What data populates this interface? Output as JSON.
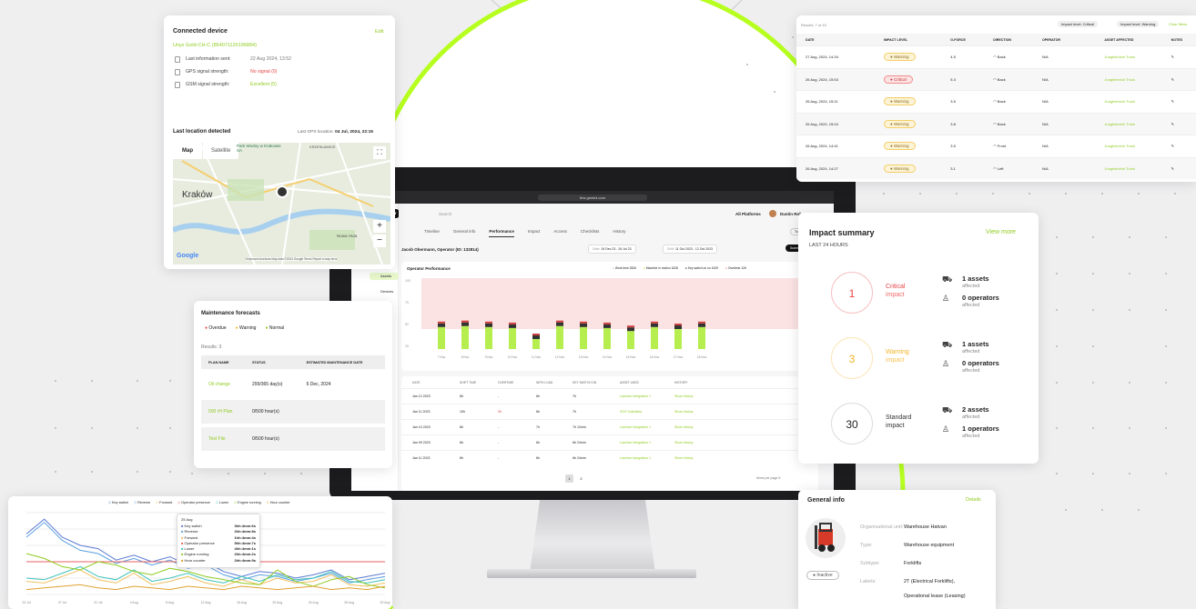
{
  "colors": {
    "accent": "#b6ff1f",
    "critical": "#e84545",
    "warning": "#f4b429",
    "link": "#8fcc20"
  },
  "connected_device": {
    "title": "Connected device",
    "edit": "Edit",
    "device_name": "Unyx Gold-CH-C (864071120196884)",
    "rows": [
      {
        "icon": "clock-icon",
        "label": "Last information sent:",
        "value": "22 Aug 2024, 13:52",
        "color": "#777"
      },
      {
        "icon": "gps-icon",
        "label": "GPS signal strength:",
        "value": "No signal (0)",
        "color": "#e84545"
      },
      {
        "icon": "signal-icon",
        "label": "GSM signal strength:",
        "value": "Excellent (5)",
        "color": "#8fcc20"
      }
    ],
    "last_location_title": "Last location detected",
    "last_gps_label": "Last GPS location:",
    "last_gps_value": "04 Jul, 2024, 22:15",
    "map_tab": "Map",
    "satellite_tab": "Satellite",
    "map_labels": [
      "Kraków",
      "Park Wodny w Krakowie SA",
      "KRZESŁAWICE",
      "Nowa Huta",
      "Google"
    ],
    "map_footer": "Keyboard shortcuts   Map data ©2024 Google   Terms   Report a map error"
  },
  "maintenance": {
    "title": "Maintenance forecasts",
    "legend": [
      {
        "label": "Overdue",
        "color": "#e84545"
      },
      {
        "label": "Warning",
        "color": "#f4b429"
      },
      {
        "label": "Normal",
        "color": "#8fcc20"
      }
    ],
    "results": "Results: 3",
    "columns": [
      "PLAN NAME",
      "STATUS",
      "ESTIMATED MAINTENANCE DATE"
    ],
    "rows": [
      {
        "name": "Oil change",
        "status": "299/365 day(s)",
        "date": "6 Dec, 2024"
      },
      {
        "name": "500 rH Plan",
        "status": "0/500 hour(s)",
        "date": ""
      },
      {
        "name": "Test File",
        "status": "0/500 hour(s)",
        "date": ""
      }
    ]
  },
  "line_chart": {
    "legend": [
      "Key switch",
      "Reverse",
      "Forward",
      "Operator presence",
      "Lower",
      "Engine running",
      "Hour counter"
    ],
    "tooltip": {
      "title": "25 Aug",
      "rows": [
        {
          "label": "Key switch",
          "value": "3hh:4mm:6s"
        },
        {
          "label": "Reverse",
          "value": "2hh:4mm:8s"
        },
        {
          "label": "Forward",
          "value": "1hh:4mm:4s"
        },
        {
          "label": "Operator presence",
          "value": "5hh:4mm:7s"
        },
        {
          "label": "Lower",
          "value": "4hh:4mm:1s"
        },
        {
          "label": "Engine running",
          "value": "2hh:4mm:2s"
        },
        {
          "label": "Hour counter",
          "value": "2hh:4mm:9s"
        }
      ]
    }
  },
  "chart_data": {
    "type": "line",
    "x": [
      "23 Jul",
      "25 Jul",
      "27 Jul",
      "29 Jul",
      "31 Jul",
      "2 Aug",
      "4 Aug",
      "6 Aug",
      "8 Aug",
      "10 Aug",
      "12 Aug",
      "14 Aug",
      "16 Aug",
      "18 Aug",
      "20 Aug",
      "22 Aug",
      "24 Aug",
      "25 Aug",
      "26 Aug",
      "28 Aug",
      "30 Aug"
    ],
    "ylim": [
      0,
      100
    ],
    "series": [
      {
        "name": "Key switch",
        "color": "#5b7bd5",
        "values": [
          74,
          92,
          70,
          60,
          56,
          42,
          48,
          40,
          46,
          36,
          40,
          28,
          22,
          28,
          26,
          20,
          24,
          30,
          18,
          22,
          26
        ]
      },
      {
        "name": "Reverse",
        "color": "#5aa0e0",
        "values": [
          70,
          88,
          66,
          54,
          50,
          38,
          44,
          36,
          42,
          32,
          36,
          24,
          18,
          24,
          22,
          16,
          20,
          26,
          14,
          18,
          22
        ]
      },
      {
        "name": "Forward",
        "color": "#f0c060",
        "values": [
          16,
          14,
          22,
          30,
          18,
          14,
          26,
          12,
          16,
          22,
          14,
          10,
          18,
          12,
          20,
          14,
          16,
          24,
          12,
          10,
          14
        ]
      },
      {
        "name": "Operator presence",
        "color": "#e86060",
        "values": [
          40,
          40,
          40,
          40,
          40,
          40,
          40,
          40,
          40,
          40,
          40,
          40,
          40,
          40,
          40,
          40,
          40,
          40,
          40,
          40,
          40
        ]
      },
      {
        "name": "Lower",
        "color": "#3dc2b8",
        "values": [
          20,
          18,
          26,
          34,
          22,
          18,
          30,
          16,
          20,
          26,
          18,
          14,
          22,
          16,
          24,
          18,
          20,
          28,
          16,
          14,
          18
        ]
      },
      {
        "name": "Engine running",
        "color": "#8fcc20",
        "values": [
          50,
          44,
          34,
          30,
          40,
          36,
          28,
          24,
          32,
          28,
          22,
          18,
          14,
          12,
          30,
          16,
          10,
          18,
          22,
          12,
          8
        ]
      },
      {
        "name": "Hour counter",
        "color": "#e0a030",
        "values": [
          6,
          8,
          10,
          12,
          8,
          6,
          10,
          8,
          6,
          10,
          8,
          6,
          10,
          8,
          6,
          8,
          10,
          6,
          8,
          6,
          10
        ]
      }
    ]
  },
  "impact_table": {
    "results": "Results: 7 of 43",
    "filters": [
      "Impact level: Critical",
      "Impact level: Warning"
    ],
    "clear_filters": "Clear filters",
    "columns": [
      "DATE",
      "IMPACT LEVEL",
      "G-FORCE",
      "DIRECTION",
      "OPERATOR",
      "ASSET AFFECTED",
      "NOTES"
    ],
    "rows": [
      {
        "date": "27 Aug, 2024, 14:34",
        "level": "Warning",
        "g": "4.5",
        "dir": "Back",
        "op": "N/A",
        "asset": "Jungheinrich Truck"
      },
      {
        "date": "26 Aug, 2024, 15:53",
        "level": "Critical",
        "g": "5.3",
        "dir": "Back",
        "op": "N/A",
        "asset": "Jungheinrich Truck"
      },
      {
        "date": "26 Aug, 2024, 15:11",
        "level": "Warning",
        "g": "3.5",
        "dir": "Back",
        "op": "N/A",
        "asset": "Jungheinrich Truck"
      },
      {
        "date": "26 Aug, 2024, 15:04",
        "level": "Warning",
        "g": "3.8",
        "dir": "Back",
        "op": "N/A",
        "asset": "Jungheinrich Truck"
      },
      {
        "date": "26 Aug, 2024, 14:41",
        "level": "Warning",
        "g": "3.5",
        "dir": "Front",
        "op": "N/A",
        "asset": "Jungheinrich Truck"
      },
      {
        "date": "26 Aug, 2024, 14:27",
        "level": "Warning",
        "g": "3.1",
        "dir": "Left",
        "op": "N/A",
        "asset": "Jungheinrich Truck"
      }
    ]
  },
  "impact_summary": {
    "title": "Impact summary",
    "view_more": "View more",
    "subtitle": "LAST 24 HOURS",
    "items": [
      {
        "count": "1",
        "label1": "Critical",
        "label2": "impact",
        "color": "#e84545",
        "assets": "1 assets",
        "operators": "0 operators",
        "affected": "affected"
      },
      {
        "count": "3",
        "label1": "Warning",
        "label2": "impact",
        "color": "#f4b429",
        "assets": "1 assets",
        "operators": "0 operators",
        "affected": "affected"
      },
      {
        "count": "30",
        "label1": "Standard",
        "label2": "impact",
        "color": "#444444",
        "assets": "2 assets",
        "operators": "1 operators",
        "affected": "affected"
      }
    ]
  },
  "general_info": {
    "title": "General info",
    "details": "Details",
    "status": "Inactive",
    "rows": [
      {
        "label": "Organisational unit:",
        "value": "Warehouse Hatvan"
      },
      {
        "label": "Type:",
        "value": "Warehouse equipment"
      },
      {
        "label": "Subtype:",
        "value": "Forklifts"
      },
      {
        "label": "Labels:",
        "value": "2T (Electrical Forklifts),"
      },
      {
        "label": "",
        "value": "Operational lease (Leasing)"
      }
    ]
  },
  "monitor": {
    "url": "fms.gemini.com",
    "logo": "Crw",
    "search": "Search",
    "user_menu": "All Platforms",
    "user_name": "Dustin Robertson",
    "tabs": [
      "Timeline",
      "General info",
      "Performance",
      "Impact",
      "Access",
      "Checklists",
      "History"
    ],
    "active_tab": "Performance",
    "side_items": [
      "Assets",
      "Devices",
      "Service"
    ],
    "tools_button": "Tools strategies",
    "header_title": "Jacob Obermann, Operator (ID: 132814)",
    "date_label": "Date:",
    "date_value": "19 Dec 23 - 26 Jul 23",
    "shift_label": "Shift:",
    "shift_value": "11 Oct 2023 - 12 Oct 2023",
    "summary_button": "Summary report",
    "perf_title": "Operator Performance",
    "perf_legend": [
      "Work time 2826",
      "Machine in motion 1628",
      "Key switch on no 1629",
      "Overtime 126"
    ],
    "table_cols": [
      "DATE",
      "SHIFT TIME",
      "OVERTIME",
      "WITH LOAD",
      "KEY SWITCH ON",
      "ASSET USED",
      "HISTORY"
    ],
    "table_rows": [
      {
        "date": "Jan 12 2023",
        "shift": "8h",
        "over": "-",
        "load": "6h",
        "key": "7h",
        "asset": "Laminar Integration 1",
        "hist": "Show history"
      },
      {
        "date": "Jan 11 2023",
        "shift": "10h",
        "over": "2h",
        "load": "6h",
        "key": "7h",
        "asset": "SGS Vulindlela",
        "hist": "Show history"
      },
      {
        "date": "Jan 10 2023",
        "shift": "8h",
        "over": "-",
        "load": "7h",
        "key": "7h 12min",
        "asset": "Laminar Integration 1",
        "hist": "Show history"
      },
      {
        "date": "Jan 09 2023",
        "shift": "8h",
        "over": "-",
        "load": "6h",
        "key": "6h 24min",
        "asset": "Laminar Integration 1",
        "hist": "Show history"
      },
      {
        "date": "Jan 11 2023",
        "shift": "8h",
        "over": "-",
        "load": "6h",
        "key": "6h 24min",
        "asset": "Laminar Integration 1",
        "hist": "Show history"
      }
    ],
    "pagination": [
      "1",
      "2"
    ],
    "rows_per_page": "Items per page 5",
    "bar_values": [
      44,
      46,
      44,
      42,
      20,
      46,
      44,
      42,
      36,
      44,
      40,
      44
    ],
    "bar_labels": [
      "7 Nov",
      "8 Nov",
      "9 Nov",
      "10 Nov",
      "11 Nov",
      "12 Nov",
      "13 Nov",
      "14 Nov",
      "15 Nov",
      "16 Nov",
      "17 Nov",
      "18 Nov"
    ],
    "y_ticks": [
      "100",
      "75",
      "50",
      "25"
    ]
  }
}
